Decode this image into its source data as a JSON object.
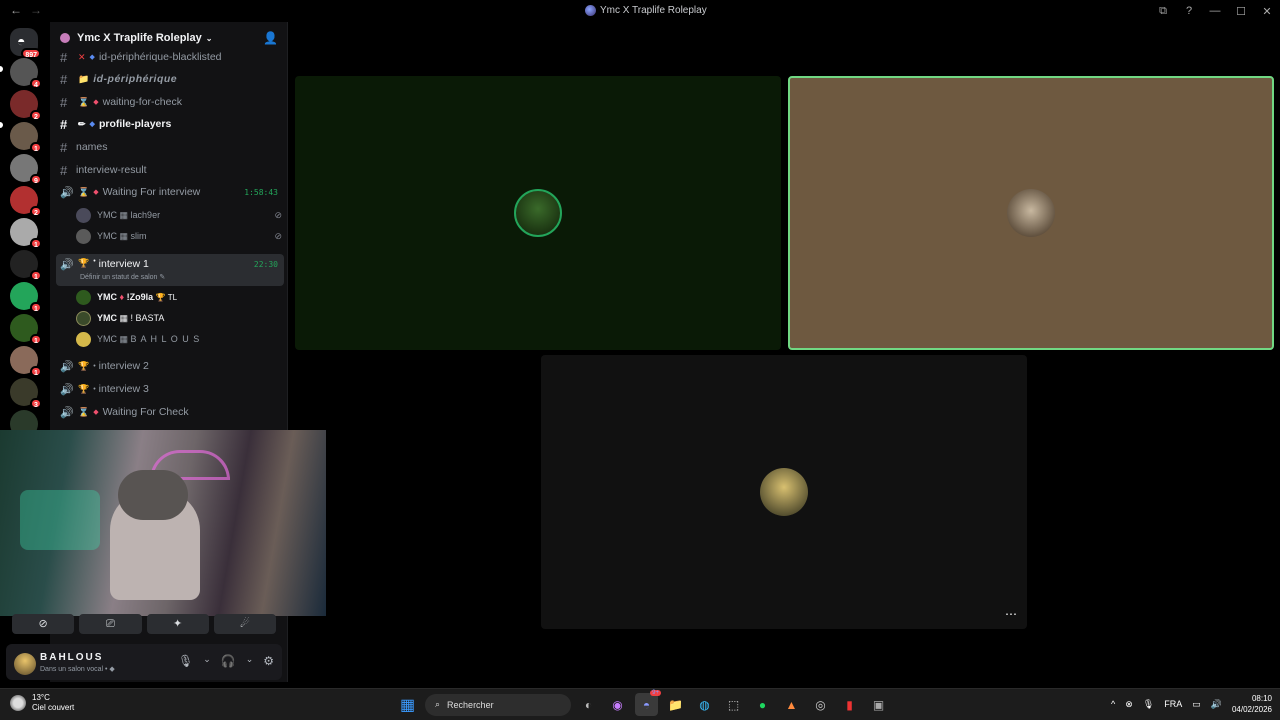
{
  "window": {
    "title": "Ymc X Traplife Roleplay",
    "back": "←",
    "forward": "→",
    "right_icons": [
      "⧉",
      "?",
      "—",
      "☐",
      "✕"
    ]
  },
  "guilds": {
    "home_badge": "897",
    "servers": [
      {
        "badge": "4",
        "color": "#555"
      },
      {
        "badge": "2",
        "color": "#7a2a2a"
      },
      {
        "badge": "1",
        "color": "#6a5a4a"
      },
      {
        "badge": "9",
        "color": "#777"
      },
      {
        "badge": "2",
        "color": "#b23030"
      },
      {
        "badge": "1",
        "color": "#aaa"
      },
      {
        "badge": "1",
        "color": "#222"
      },
      {
        "badge": "1",
        "color": "#23a55a"
      },
      {
        "badge": "1",
        "color": "#2e5a1e"
      },
      {
        "badge": "1",
        "color": "#8a6a5a"
      },
      {
        "badge": "3",
        "color": "#3a3a2a"
      },
      {
        "badge": "2",
        "color": "#2a3a2a"
      }
    ]
  },
  "server": {
    "name": "Ymc X Traplife Roleplay",
    "chevron": "⌄",
    "add_user_icon": "👤"
  },
  "channels": {
    "c1": {
      "emoji": "✕",
      "name": "id-périphérique-blacklisted"
    },
    "c2": {
      "emoji": "📁",
      "name": "id-périphérique"
    },
    "c3": {
      "emoji": "⌛",
      "name": "waiting-for-check"
    },
    "c4": {
      "emoji": "✏",
      "name": "profile-players"
    },
    "c5": {
      "name": "names"
    },
    "c6": {
      "name": "interview-result"
    },
    "v1": {
      "emoji": "⌛",
      "name": "Waiting For interview",
      "time": "1:58:43"
    },
    "v1u1": {
      "prefix": "YMC",
      "sep": "▦",
      "name": "lach9er"
    },
    "v1u2": {
      "prefix": "YMC",
      "sep": "▦",
      "name": "slim"
    },
    "v2": {
      "emoji": "🏆",
      "name": "interview 1",
      "time": "22:30",
      "status": "Définir un statut de salon ✎"
    },
    "v2u1": {
      "prefix": "YMC",
      "sep": "♦",
      "name": "!Zo9la",
      "tag": "🏆 TL"
    },
    "v2u2": {
      "prefix": "YMC",
      "sep": "▦",
      "name": "! BASTA"
    },
    "v2u3": {
      "prefix": "YMC",
      "sep": "▦",
      "name": "B A H L O U S"
    },
    "v3": {
      "emoji": "🏆",
      "name": "interview 2"
    },
    "v4": {
      "emoji": "🏆",
      "name": "interview 3"
    },
    "v5": {
      "emoji": "⌛",
      "name": "Waiting For Check"
    }
  },
  "icons": {
    "hash": "#",
    "speaker": "🔊",
    "mute": "⊘",
    "dot": "◆"
  },
  "controls": [
    "⊘",
    "⎚",
    "✦",
    "☄"
  ],
  "user": {
    "name": "BAHLOUS",
    "status": "Dans un salon vocal • ◆",
    "icons": [
      "🎙",
      "⌄",
      "🎧",
      "⌄",
      "⚙"
    ]
  },
  "stage": {
    "tile1_color": "#0a1a06",
    "tile2_color": "#6e5940",
    "tile3_color": "#111111",
    "tile2_border": "#71d883",
    "more_icon": "⋯"
  },
  "taskbar": {
    "temp": "13°C",
    "weather": "Ciel couvert",
    "search": "Rechercher",
    "apps": [
      "▦",
      "◐",
      "◉",
      "📁",
      "◍",
      "⬚",
      "●",
      "▲",
      "◎",
      "▮",
      "▣"
    ],
    "discord_badge": "9+",
    "tray_up": "^",
    "lang": "FRA",
    "time": "08:10",
    "date": "04/02/2026"
  }
}
